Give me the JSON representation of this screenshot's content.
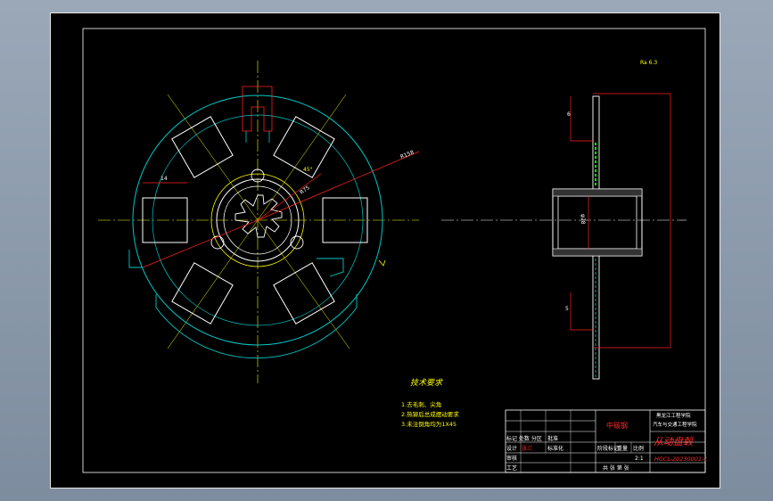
{
  "colors": {
    "background": "#000000",
    "cyan": "#00c8c8",
    "yellow": "#ffff00",
    "red": "#ff2020",
    "white": "#ffffff",
    "green": "#00ff00"
  },
  "drawing": {
    "roughness_mark": "Ra 6.3",
    "dims": {
      "radial_1": "R158",
      "radial_2": "R75",
      "angle": "45°",
      "slot_width": "14",
      "phi_inner": "φ28",
      "hub_width": "6",
      "bottom_dim": "5"
    }
  },
  "tech_requirements": {
    "title": "技术要求",
    "items": [
      "1.去毛刺、尖角",
      "2.热铆后总成摆动要求",
      "3.未注倒角均为1X45"
    ]
  },
  "title_block": {
    "material": "中碳钢",
    "school_line1": "黑龙江工程学院",
    "school_line2": "汽车与交通工程学院",
    "part_name": "从动盘毂",
    "drawing_no": "HGCL-20230001-1",
    "scale_label": "比例",
    "scale_value": "2:1",
    "stage_label": "阶段标记",
    "weight_label": "重量",
    "sheet_text": "共 张 第 张",
    "rows": [
      "标记 处数 分区",
      "设计",
      "审核",
      "工艺"
    ],
    "cols": [
      "更改文件号",
      "签名",
      "年月日"
    ],
    "std_label": "标准化",
    "approve_label": "批准",
    "red_name": "张三"
  }
}
